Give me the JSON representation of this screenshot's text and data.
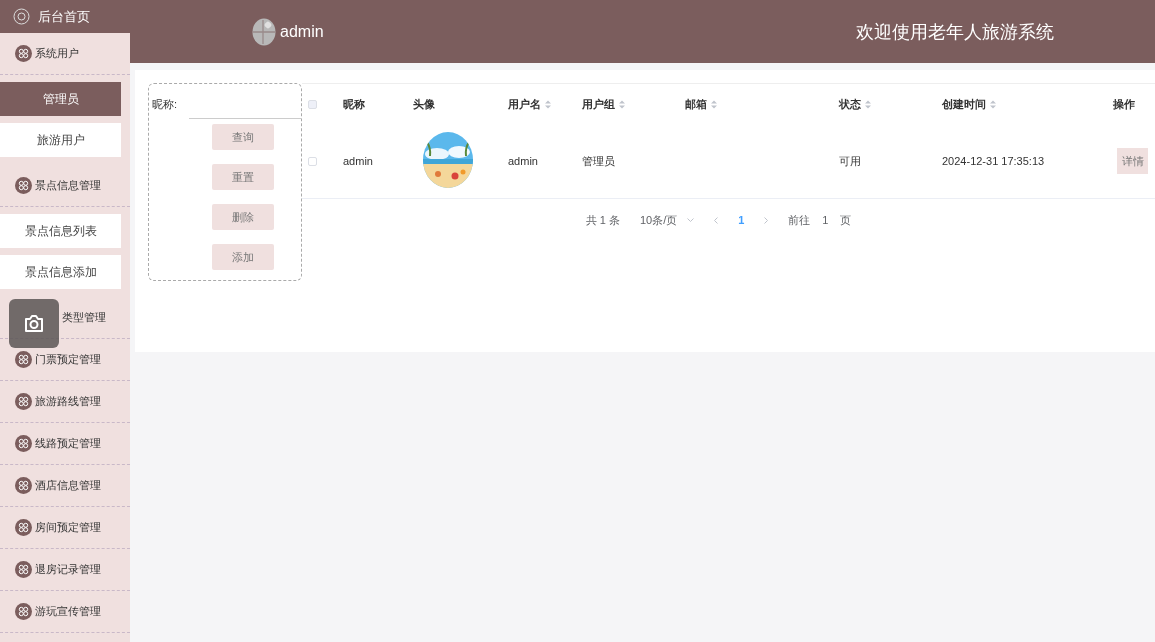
{
  "sidebar": {
    "home": "后台首页",
    "groups": [
      {
        "label": "系统用户",
        "kind": "icon",
        "children": [
          {
            "label": "管理员",
            "selected": true
          },
          {
            "label": "旅游用户",
            "selected": false
          }
        ]
      },
      {
        "label": "景点信息管理",
        "kind": "icon",
        "children": [
          {
            "label": "景点信息列表",
            "selected": false
          },
          {
            "label": "景点信息添加",
            "selected": false
          }
        ]
      },
      {
        "label": "类型管理",
        "kind": "covered"
      },
      {
        "label": "门票预定管理",
        "kind": "icon"
      },
      {
        "label": "旅游路线管理",
        "kind": "icon"
      },
      {
        "label": "线路预定管理",
        "kind": "icon"
      },
      {
        "label": "酒店信息管理",
        "kind": "icon"
      },
      {
        "label": "房间预定管理",
        "kind": "icon"
      },
      {
        "label": "退房记录管理",
        "kind": "icon"
      },
      {
        "label": "游玩宣传管理",
        "kind": "icon"
      }
    ]
  },
  "header": {
    "user": "admin",
    "title": "欢迎使用老年人旅游系统"
  },
  "search": {
    "label": "昵称:",
    "buttons": [
      "查询",
      "重置",
      "删除",
      "添加"
    ]
  },
  "table": {
    "columns": [
      {
        "label": "昵称",
        "sortable": false
      },
      {
        "label": "头像",
        "sortable": false
      },
      {
        "label": "用户名",
        "sortable": true
      },
      {
        "label": "用户组",
        "sortable": true
      },
      {
        "label": "邮箱",
        "sortable": true
      },
      {
        "label": "状态",
        "sortable": true
      },
      {
        "label": "创建时间",
        "sortable": true
      },
      {
        "label": "操作",
        "sortable": false
      }
    ],
    "all_selected": false,
    "rows": [
      {
        "selected": false,
        "nickname": "admin",
        "username": "admin",
        "group": "管理员",
        "status": "可用",
        "created": "2024-12-31 17:35:13",
        "action": "详情"
      }
    ]
  },
  "pagination": {
    "total": "共 1 条",
    "page_size": "10条/页",
    "pages": [
      {
        "label": "1",
        "selected": true
      }
    ],
    "goto": "前往",
    "goto_value": "1",
    "page_suffix": "页"
  }
}
